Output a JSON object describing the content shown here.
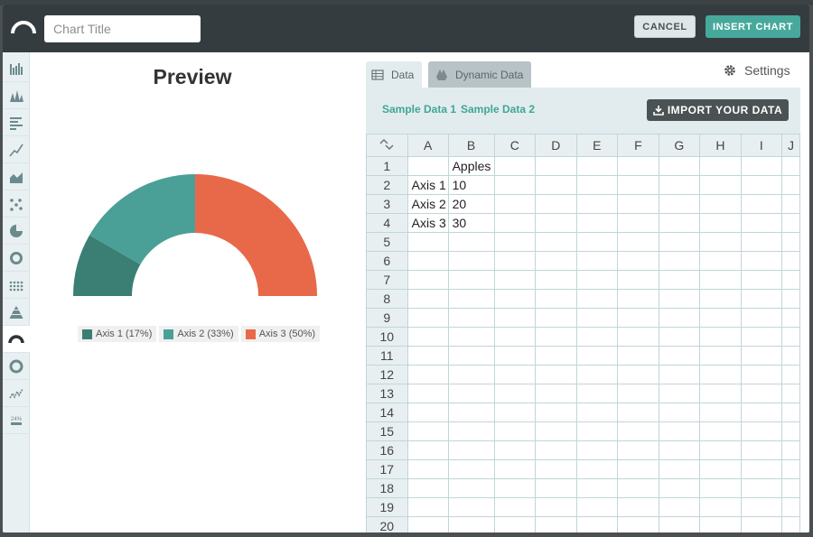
{
  "header": {
    "title_placeholder": "Chart Title",
    "cancel_label": "CANCEL",
    "insert_label": "INSERT CHART"
  },
  "sidebar": {
    "items": [
      {
        "icon": "bar-chart-icon"
      },
      {
        "icon": "area-spike-chart-icon"
      },
      {
        "icon": "horizontal-bar-chart-icon"
      },
      {
        "icon": "line-chart-icon"
      },
      {
        "icon": "area-chart-icon"
      },
      {
        "icon": "scatter-chart-icon"
      },
      {
        "icon": "pie-chart-icon"
      },
      {
        "icon": "donut-chart-icon"
      },
      {
        "icon": "dot-matrix-chart-icon"
      },
      {
        "icon": "pyramid-chart-icon"
      },
      {
        "icon": "semi-donut-chart-icon",
        "active": true
      },
      {
        "icon": "ring-chart-icon"
      },
      {
        "icon": "sparkline-chart-icon"
      },
      {
        "icon": "percent-number-icon"
      }
    ]
  },
  "preview": {
    "heading": "Preview"
  },
  "chart_data": {
    "type": "pie",
    "subtype": "semi-donut",
    "categories": [
      "Axis 1",
      "Axis 2",
      "Axis 3"
    ],
    "values": [
      10,
      20,
      30
    ],
    "legend": [
      "Axis 1 (17%)",
      "Axis 2 (33%)",
      "Axis 3 (50%)"
    ],
    "colors": [
      "#3b7e73",
      "#4aa096",
      "#e8694a"
    ],
    "legend_position": "bottom"
  },
  "tabs": {
    "data": "Data",
    "dynamic": "Dynamic Data",
    "settings": "Settings"
  },
  "data_bar": {
    "sample1": "Sample Data 1",
    "sample2": "Sample Data 2",
    "import_label": "IMPORT YOUR DATA"
  },
  "sheet": {
    "columns": [
      "A",
      "B",
      "C",
      "D",
      "E",
      "F",
      "G",
      "H",
      "I",
      "J"
    ],
    "rows": 20,
    "cells": [
      [
        "",
        "Apples"
      ],
      [
        "Axis 1",
        "10"
      ],
      [
        "Axis 2",
        "20"
      ],
      [
        "Axis 3",
        "30"
      ]
    ]
  },
  "colors": {
    "accent": "#46a99b",
    "header_bg": "#343c3f"
  }
}
